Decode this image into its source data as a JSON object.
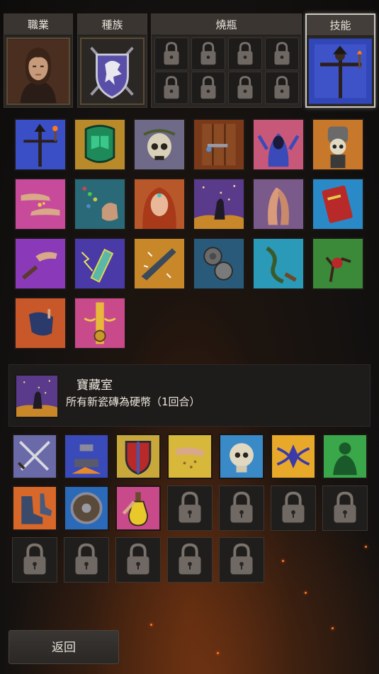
{
  "tabs": [
    {
      "label": "職業",
      "icon": "character-portrait-icon"
    },
    {
      "label": "種族",
      "icon": "eagle-crest-shield-icon"
    },
    {
      "label": "燒瓶",
      "icon": "padlock-icon"
    },
    {
      "label": "技能",
      "icon": "scarecrow-skill-icon",
      "active": true
    }
  ],
  "skills": [
    "scarecrow-icon",
    "green-armor-icon",
    "thorn-skull-icon",
    "wooden-door-icon",
    "hooded-figure-icon",
    "skeleton-knight-icon",
    "coin-hands-icon",
    "beads-fist-icon",
    "red-haired-woman-icon",
    "treasure-room-icon",
    "praying-hands-icon",
    "red-book-icon",
    "pointing-hand-icon",
    "lightning-crystal-icon",
    "shattering-blade-icon",
    "coins-icon",
    "serpent-staff-icon",
    "hand-tree-icon",
    "gloved-hand-icon",
    "golden-pillar-icon"
  ],
  "selected": {
    "icon": "treasure-room-icon",
    "title": "寶藏室",
    "description": "所有新瓷磚為硬幣（1回合）"
  },
  "items": [
    "crossed-swords-icon",
    "anvil-hammer-icon",
    "shield-icon",
    "sand-hand-icon",
    "cracked-skull-icon",
    "winged-emblem-icon",
    "green-figure-icon",
    "boots-icon",
    "round-shield-icon",
    "potion-icon",
    "padlock-icon",
    "padlock-icon",
    "padlock-icon",
    "padlock-icon",
    "padlock-icon",
    "padlock-icon",
    "padlock-icon",
    "padlock-icon",
    "padlock-icon"
  ],
  "back_label": "返回",
  "colors": {
    "accent": "#cfcac0",
    "panel": "#1e1c1b",
    "frame": "#5a4a38"
  }
}
